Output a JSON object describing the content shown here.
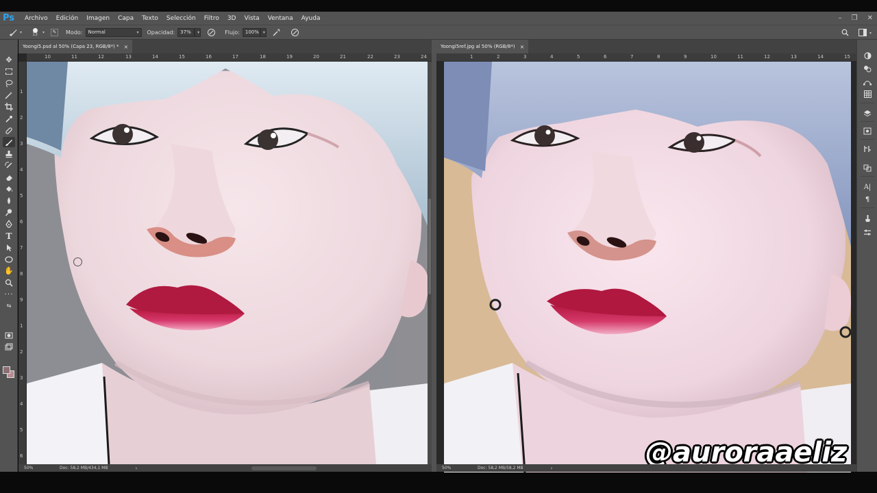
{
  "app": {
    "logo": "Ps"
  },
  "menu": [
    "Archivo",
    "Edición",
    "Imagen",
    "Capa",
    "Texto",
    "Selección",
    "Filtro",
    "3D",
    "Vista",
    "Ventana",
    "Ayuda"
  ],
  "window_controls": {
    "minimize": "–",
    "restore": "❐",
    "close": "✕"
  },
  "options": {
    "brush_size": "13",
    "mode_label": "Modo:",
    "mode_value": "Normal",
    "opacity_label": "Opacidad:",
    "opacity_value": "37%",
    "flow_label": "Flujo:",
    "flow_value": "100%"
  },
  "documents": [
    {
      "tab_title": "Yoongi5.psd al 50% (Capa 23, RGB/8*) *",
      "close": "×",
      "zoom": "50%",
      "doc_info": "Doc: 58,2 MB/434,1 MB",
      "status_arrow": "›",
      "ruler_h": [
        "10",
        "11",
        "12",
        "13",
        "14",
        "15",
        "16",
        "17",
        "18",
        "19",
        "20",
        "21",
        "22",
        "23",
        "24"
      ],
      "ruler_v": [
        "1",
        "2",
        "3",
        "4",
        "5",
        "6",
        "7",
        "8",
        "9",
        "1",
        "2",
        "3",
        "4",
        "5",
        "6",
        "7"
      ]
    },
    {
      "tab_title": "Yoongi5ref.jpg al 50% (RGB/8*)",
      "close": "×",
      "zoom": "50%",
      "doc_info": "Doc: 58,2 MB/58,2 MB",
      "status_arrow": "›",
      "ruler_h": [
        "1",
        "2",
        "3",
        "4",
        "5",
        "6",
        "7",
        "8",
        "9",
        "10",
        "11",
        "12",
        "13",
        "14",
        "15"
      ]
    }
  ],
  "watermark": "@auroraaeliz",
  "icons": {
    "tools": [
      "move-icon",
      "marquee-icon",
      "lasso-icon",
      "magic-wand-icon",
      "crop-icon",
      "eyedropper-icon",
      "healing-brush-icon",
      "brush-icon",
      "clone-stamp-icon",
      "history-brush-icon",
      "eraser-icon",
      "paint-bucket-icon",
      "blur-icon",
      "dodge-icon",
      "pen-icon",
      "type-icon",
      "path-selection-icon",
      "shape-icon",
      "hand-icon",
      "zoom-icon",
      "more-tools-icon"
    ],
    "colors": {
      "foreground": "#8c6e72",
      "background": "#b88d92"
    }
  }
}
